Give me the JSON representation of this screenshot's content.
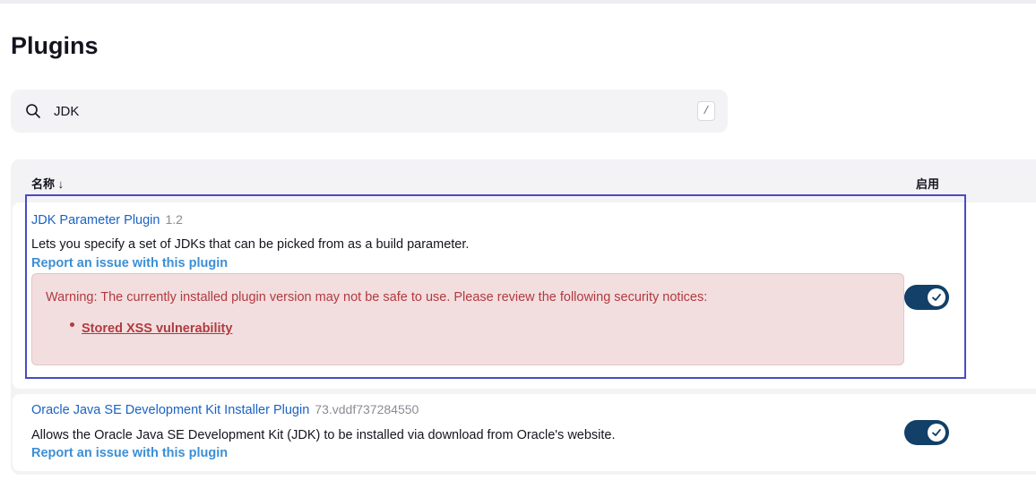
{
  "page": {
    "title": "Plugins"
  },
  "search": {
    "value": "JDK",
    "shortcut_hint": "/"
  },
  "table": {
    "col_name": "名称 ↓",
    "col_enabled": "启用"
  },
  "plugins": [
    {
      "name": "JDK Parameter Plugin",
      "version": "1.2",
      "description": "Lets you specify a set of JDKs that can be picked from as a build parameter.",
      "report_link": "Report an issue with this plugin",
      "warning": {
        "text": "Warning: The currently installed plugin version may not be safe to use. Please review the following security notices:",
        "notices": [
          "Stored XSS vulnerability"
        ]
      },
      "enabled": true
    },
    {
      "name": "Oracle Java SE Development Kit Installer Plugin",
      "version": "73.vddf737284550",
      "description": "Allows the Oracle Java SE Development Kit (JDK) to be installed via download from Oracle's website.",
      "report_link": "Report an issue with this plugin",
      "enabled": true
    }
  ],
  "colors": {
    "link": "#1a62c4",
    "report_link": "#3b8fd6",
    "warning_bg": "#f2dedf",
    "warning_text": "#b13a3f",
    "toggle_on": "#124068",
    "highlight_border": "#4a4ac8"
  },
  "icons": {
    "search": "search-icon",
    "toggle_check": "check-icon"
  }
}
